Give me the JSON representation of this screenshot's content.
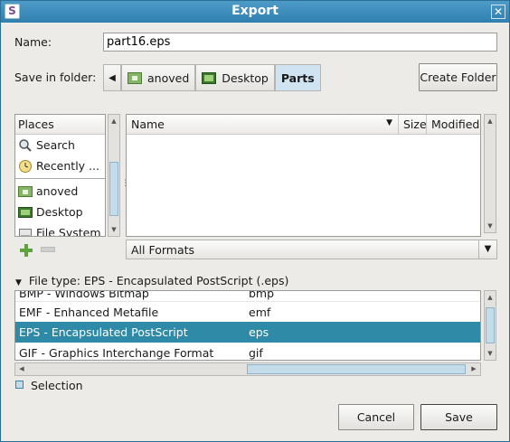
{
  "window": {
    "title": "Export",
    "close_glyph": "✕",
    "app_icon": "S"
  },
  "name": {
    "label": "Name:",
    "value": "part16.eps"
  },
  "save_in": {
    "label": "Save in folder:",
    "crumbs": [
      {
        "label": "anoved",
        "icon": "folder-icon"
      },
      {
        "label": "Desktop",
        "icon": "desktop-icon"
      },
      {
        "label": "Parts",
        "active": true
      }
    ],
    "create_folder": "Create Folder"
  },
  "places": {
    "header": "Places",
    "items": [
      {
        "label": "Search",
        "icon": "search-icon"
      },
      {
        "label": "Recently ...",
        "icon": "recent-icon"
      },
      {
        "label": "anoved",
        "icon": "home-folder-icon"
      },
      {
        "label": "Desktop",
        "icon": "desktop-icon"
      },
      {
        "label": "File System",
        "icon": "drive-icon"
      }
    ]
  },
  "files": {
    "columns": [
      "Name",
      "Size",
      "Modified"
    ],
    "rows": []
  },
  "filter": {
    "selected": "All Formats"
  },
  "file_type": {
    "header": "File type: EPS - Encapsulated PostScript (.eps)",
    "rows": [
      {
        "name": "BMP - Windows Bitmap",
        "ext": "bmp"
      },
      {
        "name": "EMF - Enhanced Metafile",
        "ext": "emf"
      },
      {
        "name": "EPS - Encapsulated PostScript",
        "ext": "eps",
        "selected": true
      },
      {
        "name": "GIF - Graphics Interchange Format",
        "ext": "gif"
      }
    ]
  },
  "selection": {
    "label": "Selection"
  },
  "buttons": {
    "cancel": "Cancel",
    "save": "Save"
  },
  "colors": {
    "title_bar": "#3a8bbd",
    "selection": "#2e8aa6",
    "accent_crumb": "#cfe3f0"
  }
}
